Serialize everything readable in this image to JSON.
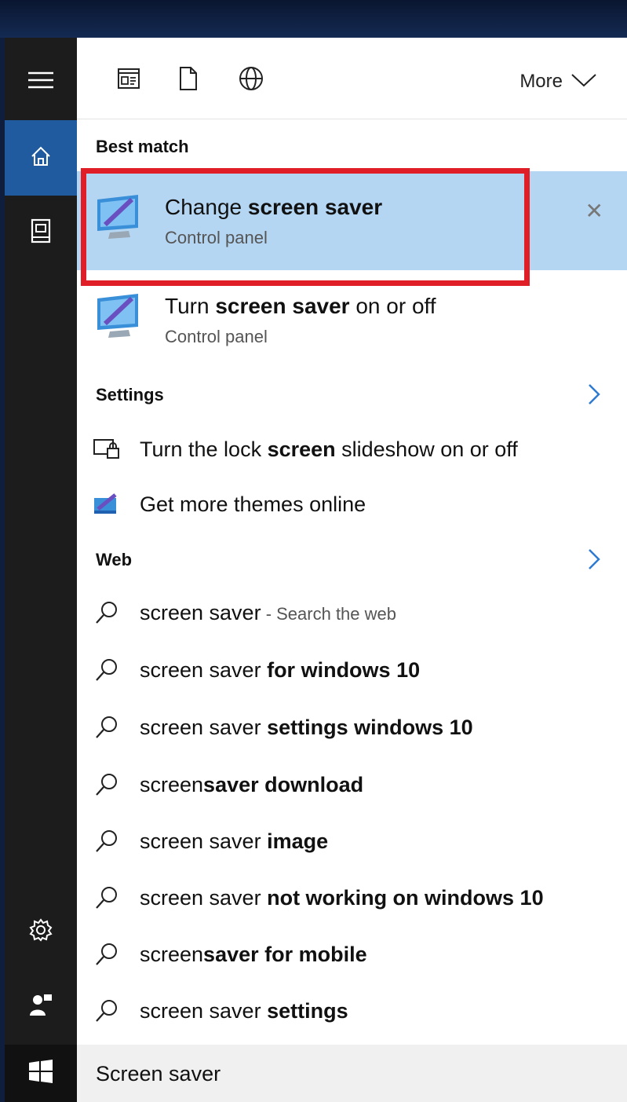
{
  "topbar": {
    "filters": [
      {
        "icon": "apps-filter-icon"
      },
      {
        "icon": "documents-filter-icon"
      },
      {
        "icon": "web-filter-icon"
      }
    ],
    "more_label": "More"
  },
  "sidebar": {
    "items": [
      {
        "icon": "hamburger-menu-icon"
      },
      {
        "icon": "home-icon"
      },
      {
        "icon": "notebook-icon"
      },
      {
        "icon": "settings-gear-icon"
      },
      {
        "icon": "feedback-icon"
      }
    ]
  },
  "best_match": {
    "heading": "Best match",
    "items": [
      {
        "title_prefix": "Change ",
        "title_bold": "screen saver",
        "title_suffix": "",
        "subtitle": "Control panel",
        "selected": true
      },
      {
        "title_prefix": "Turn ",
        "title_bold": "screen saver",
        "title_suffix": " on or off",
        "subtitle": "Control panel",
        "selected": false
      }
    ]
  },
  "settings": {
    "heading": "Settings",
    "items": [
      {
        "prefix": "Turn the lock ",
        "bold": "screen",
        "suffix": " slideshow on or off",
        "icon": "lock-screen-icon"
      },
      {
        "prefix": "Get more themes online",
        "bold": "",
        "suffix": "",
        "icon": "themes-icon"
      }
    ]
  },
  "web": {
    "heading": "Web",
    "items": [
      {
        "prefix": "screen saver",
        "bold": "",
        "hint": " - Search the web"
      },
      {
        "prefix": "screen saver ",
        "bold": "for windows 10",
        "hint": ""
      },
      {
        "prefix": "screen saver ",
        "bold": "settings windows 10",
        "hint": ""
      },
      {
        "prefix": "screen",
        "bold": "saver download",
        "hint": ""
      },
      {
        "prefix": "screen saver ",
        "bold": "image",
        "hint": ""
      },
      {
        "prefix": "screen saver ",
        "bold": "not working on windows 10",
        "hint": ""
      },
      {
        "prefix": "screen",
        "bold": "saver for mobile",
        "hint": ""
      },
      {
        "prefix": "screen saver ",
        "bold": "settings",
        "hint": ""
      }
    ]
  },
  "search": {
    "value": "Screen saver"
  },
  "colors": {
    "accent": "#1f5b9e",
    "selected": "#b4d6f2",
    "highlight": "#e01e28",
    "link_arrow": "#2f7bd1"
  }
}
